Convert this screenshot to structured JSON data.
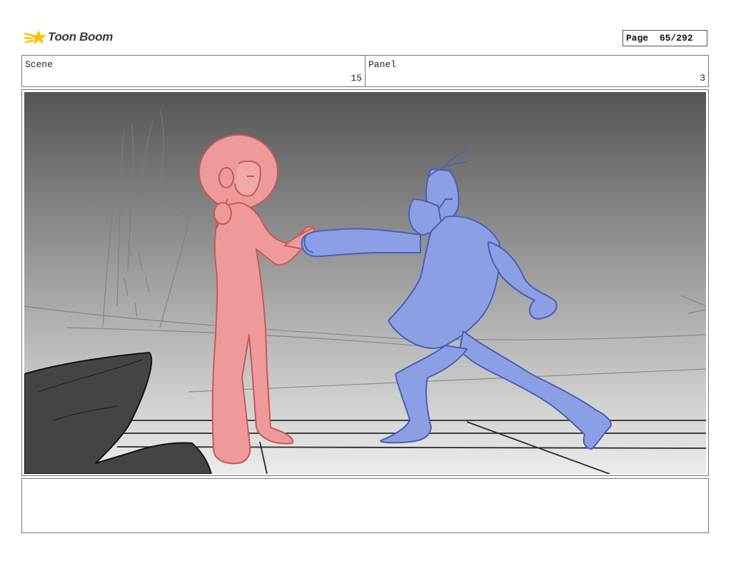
{
  "logo": {
    "text": "Toon Boom",
    "icon": "toon-boom-star-icon",
    "accent": "#f5c400"
  },
  "page": {
    "label": "Page",
    "value": "65/292"
  },
  "scene": {
    "label": "Scene",
    "value": "15"
  },
  "panel": {
    "label": "Panel",
    "value": "3"
  },
  "artwork": {
    "colors": {
      "bg_top": "#555555",
      "bg_bottom": "#ececec",
      "character_red": "#ee9a9a",
      "character_blue": "#8c9fe4",
      "rock": "#444444"
    }
  },
  "notes": {
    "text": ""
  }
}
